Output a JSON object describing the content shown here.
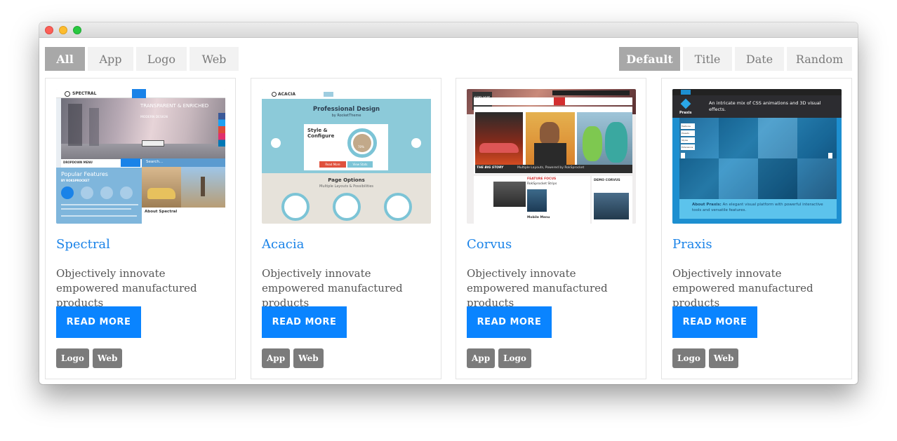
{
  "filters": {
    "categories": [
      "All",
      "App",
      "Logo",
      "Web"
    ],
    "sorts": [
      "Default",
      "Title",
      "Date",
      "Random"
    ]
  },
  "cards": [
    {
      "title": "Spectral",
      "description": "Objectively innovate empowered manufactured products",
      "button": "READ MORE",
      "tags": [
        "Logo",
        "Web"
      ],
      "thumb": {
        "brand": "SPECTRAL",
        "hero": "TRANSPARENT & ENRICHED",
        "sub": "MODERN DESIGN",
        "dropdown": "DROPDOWN MENU",
        "popular": "Popular Features",
        "by": "BY ROKSPROCKET",
        "search": "Search...",
        "about": "About Spectral"
      }
    },
    {
      "title": "Acacia",
      "description": "Objectively innovate empowered manufactured products",
      "button": "READ MORE",
      "tags": [
        "App",
        "Web"
      ],
      "thumb": {
        "brand": "ACACIA",
        "hero": "Professional Design",
        "sub": "by RocketTheme",
        "style": "Style & Configure",
        "page_options": "Page Options",
        "layouts": "Multiple Layouts & Possibilities",
        "read_more": "Read More",
        "view_stats": "View Stats",
        "percent": "70%"
      }
    },
    {
      "title": "Corvus",
      "description": "Objectively innovate empowered manufactured products",
      "button": "READ MORE",
      "tags": [
        "App",
        "Logo"
      ],
      "thumb": {
        "brand": "COR VUS",
        "big_story": "THE BIG STORY",
        "tagline": "Multiple Layouts, Powered by RokSprocket",
        "feature": "FEATURE FOCUS",
        "demo": "DEMO CORVUS",
        "mobile": "Mobile Menu",
        "rok": "RokSprocket Strips"
      }
    },
    {
      "title": "Praxis",
      "description": "Objectively innovate empowered manufactured products",
      "button": "READ MORE",
      "tags": [
        "Logo",
        "Web"
      ],
      "thumb": {
        "brand": "Praxis",
        "hero": "An intricate mix of CSS animations and 3D visual effects.",
        "about_label": "About Praxis:",
        "about": "An elegant visual platform with powerful interactive tools and versatile features.",
        "menu": [
          "Features",
          "Presets",
          "Styles",
          "Extensions"
        ]
      }
    }
  ]
}
